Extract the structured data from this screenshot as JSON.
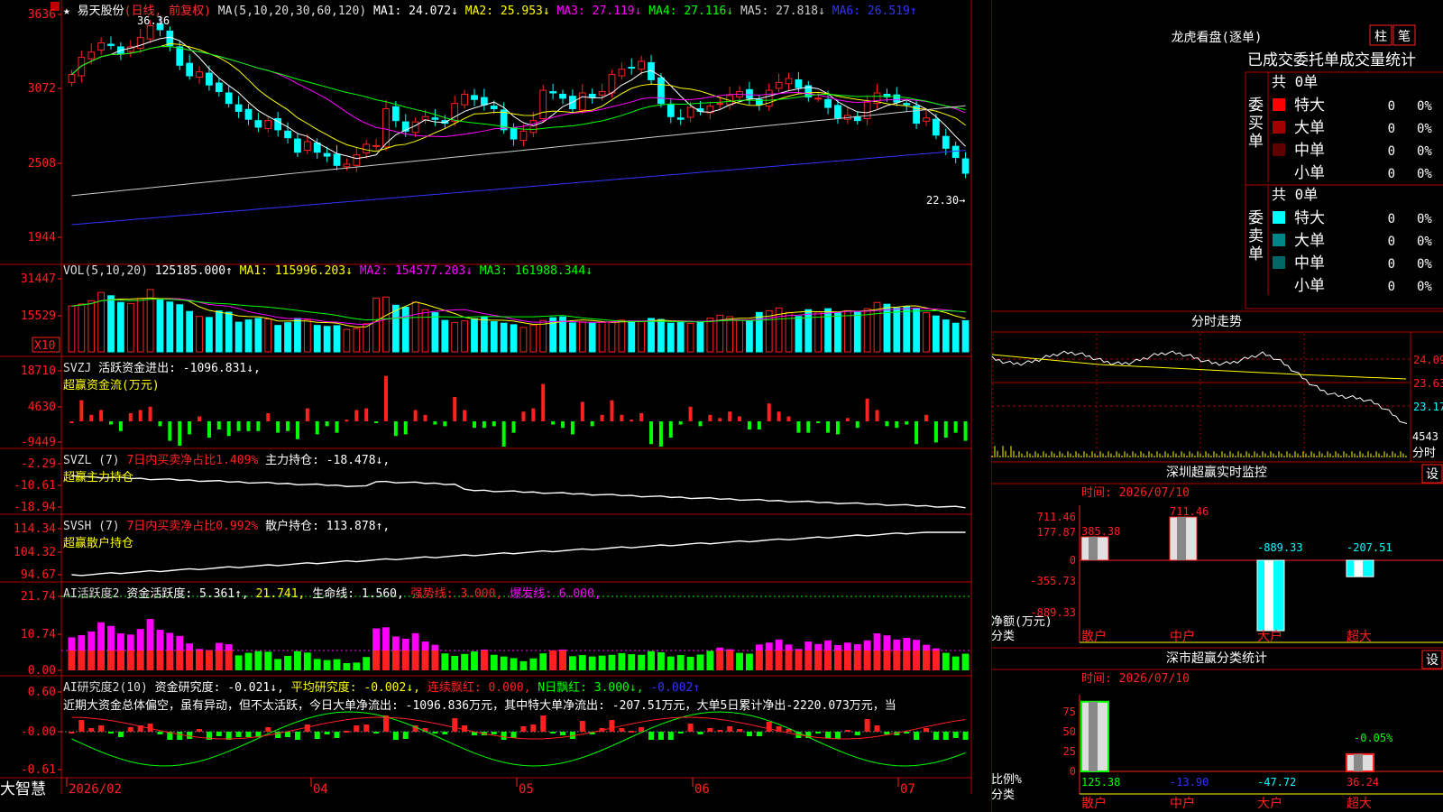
{
  "colors": {
    "up": "#ff2020",
    "down": "#00ffff",
    "grid": "#b00000",
    "bg": "#000000",
    "axis": "#ff3030"
  },
  "stock": {
    "name": "★ 易天股份",
    "mode": "(日线, 前复权)"
  },
  "main": {
    "ma_label": "MA(5,10,20,30,60,120)",
    "ma_items": [
      {
        "t": "MA1: 24.072↓",
        "c": "#ffffff"
      },
      {
        "t": "MA2: 25.953↓",
        "c": "#ffff00"
      },
      {
        "t": "MA3: 27.119↓",
        "c": "#ff00ff"
      },
      {
        "t": "MA4: 27.116↓",
        "c": "#00ff00"
      },
      {
        "t": "MA5: 27.818↓",
        "c": "#cccccc"
      },
      {
        "t": "MA6: 26.519↑",
        "c": "#3333ff"
      }
    ],
    "y_ticks": [
      "3636",
      "3072",
      "2508",
      "1944"
    ],
    "high_label": "36.36",
    "low_label": "22.30"
  },
  "vol": {
    "label": "VOL(5,10,20)",
    "value": "125185.000↑",
    "items": [
      {
        "t": "MA1: 115996.203↓",
        "c": "#ffff00"
      },
      {
        "t": "MA2: 154577.203↓",
        "c": "#ff00ff"
      },
      {
        "t": "MA3: 161988.344↓",
        "c": "#00ff00"
      }
    ],
    "y_ticks": [
      "31447",
      "15529"
    ],
    "unit": "X10"
  },
  "svzj": {
    "label": "SVZJ",
    "title": "活跃资金进出: -1096.831↓,",
    "sub": "超赢资金流(万元)",
    "y_ticks": [
      "18710",
      "4630",
      "-9449"
    ]
  },
  "svzl": {
    "label": "SVZL (7)",
    "pct": "7日内买卖净占比1.409%",
    "title": "主力持仓: -18.478↓,",
    "sub": "超赢主力持仓",
    "y_ticks": [
      "-2.29",
      "-10.61",
      "-18.94"
    ]
  },
  "svsh": {
    "label": "SVSH (7)",
    "pct": "7日内买卖净占比0.992%",
    "title": "散户持仓: 113.878↑,",
    "sub": "超赢散户持仓",
    "y_ticks": [
      "114.34",
      "104.32",
      "94.67"
    ]
  },
  "ai1": {
    "label": "AI活跃度2",
    "items": [
      {
        "t": "资金活跃度: 5.361↑,",
        "c": "#ffffff"
      },
      {
        "t": "21.741,",
        "c": "#ffff00"
      },
      {
        "t": "生命线: 1.560,",
        "c": "#ffffff"
      },
      {
        "t": "强势线: 3.000,",
        "c": "#ff2020"
      },
      {
        "t": "爆发线: 6.000,",
        "c": "#ff00ff"
      }
    ],
    "y_ticks": [
      "21.74",
      "10.74",
      "0.00"
    ]
  },
  "ai2": {
    "label": "AI研究度2(10)",
    "items": [
      {
        "t": "资金研究度: -0.021↓,",
        "c": "#ffffff"
      },
      {
        "t": "平均研究度: -0.002↓,",
        "c": "#ffff00"
      },
      {
        "t": "连续飘红: 0.000,",
        "c": "#ff2020"
      },
      {
        "t": "N日飘红: 3.000↓,",
        "c": "#00ff00"
      },
      {
        "t": "-0.002↑",
        "c": "#3333ff"
      }
    ],
    "comment": "近期大资金总体偏空，虽有异动，但不太活跃，今日大单净流出: -1096.836万元，其中特大单净流出: -207.51万元，大单5日累计净出-2220.073万元，当",
    "y_ticks": [
      "0.60",
      "-0.00",
      "-0.61"
    ]
  },
  "x_axis": {
    "labels": [
      "2026/02",
      "04",
      "05",
      "06",
      "07"
    ],
    "brand": "大智慧"
  },
  "right": {
    "dragon_title": "龙虎看盘(逐单)",
    "tab_zhu": "柱",
    "tab_bi": "笔",
    "stats_title": "已成交委托单成交量统计",
    "buy": {
      "side": "委买单",
      "total": "共 0单",
      "rows": [
        {
          "n": "特大",
          "v": "0",
          "p": "0%",
          "c": "#ff0000"
        },
        {
          "n": "大单",
          "v": "0",
          "p": "0%",
          "c": "#a00000"
        },
        {
          "n": "中单",
          "v": "0",
          "p": "0%",
          "c": "#600000"
        },
        {
          "n": "小单",
          "v": "0",
          "p": "0%",
          "c": "#000000"
        }
      ]
    },
    "sell": {
      "side": "委卖单",
      "total": "共 0单",
      "rows": [
        {
          "n": "特大",
          "v": "0",
          "p": "0%",
          "c": "#00ffff"
        },
        {
          "n": "大单",
          "v": "0",
          "p": "0%",
          "c": "#008888"
        },
        {
          "n": "中单",
          "v": "0",
          "p": "0%",
          "c": "#006666"
        },
        {
          "n": "小单",
          "v": "0",
          "p": "0%",
          "c": "#000000"
        }
      ]
    },
    "timeshare": {
      "title": "分时走势",
      "y_ticks": [
        "24.09",
        "23.63",
        "23.17"
      ],
      "vol": "4543",
      "unit": "分时"
    },
    "monitor": {
      "title": "深圳超赢实时监控",
      "btn": "设",
      "date": "时间: 2026/07/10",
      "y_ticks": [
        "711.46",
        "177.87",
        "0",
        "-355.73",
        "-889.33"
      ],
      "y_label": "净额(万元)",
      "cat_label": "分类",
      "cats": [
        "散户",
        "中户",
        "大户",
        "超大"
      ],
      "values": [
        385.38,
        711.46,
        -889.33,
        -207.51
      ],
      "value_labels": [
        "385.38",
        "711.46",
        "-889.33",
        "-207.51"
      ]
    },
    "classify": {
      "title": "深市超赢分类统计",
      "btn": "设",
      "date": "时间: 2026/07/10",
      "y_ticks": [
        "75",
        "50",
        "25",
        "0"
      ],
      "y_label": "比例%",
      "cat_label": "分类",
      "cats": [
        "散户",
        "中户",
        "大户",
        "超大"
      ],
      "values": [
        125.38,
        -13.9,
        -47.72,
        36.24
      ],
      "value_labels": [
        "125.38",
        "-13.90",
        "-47.72",
        "36.24"
      ],
      "pct_label": "-0.05%"
    }
  },
  "chart_data": {
    "type": "candlestick",
    "title": "易天股份",
    "x_labels": [
      "2026/02",
      "04",
      "05",
      "06",
      "07"
    ],
    "close": [
      31.8,
      33.1,
      33.5,
      34.2,
      34.0,
      33.4,
      33.9,
      34.6,
      35.5,
      35.2,
      34.0,
      32.5,
      31.7,
      32.0,
      31.0,
      30.5,
      29.6,
      29.0,
      28.4,
      27.8,
      28.3,
      27.6,
      27.0,
      25.9,
      26.7,
      25.9,
      25.6,
      24.9,
      25.0,
      25.7,
      26.5,
      26.4,
      29.2,
      28.3,
      27.5,
      28.2,
      28.6,
      28.4,
      28.1,
      29.6,
      30.3,
      29.9,
      29.5,
      29.2,
      27.6,
      26.9,
      27.5,
      28.3,
      30.6,
      30.4,
      30.0,
      29.2,
      30.4,
      30.1,
      30.5,
      31.8,
      32.2,
      32.3,
      32.8,
      31.4,
      29.6,
      28.6,
      28.4,
      29.3,
      29.0,
      29.4,
      29.6,
      30.2,
      30.5,
      30.0,
      29.5,
      30.6,
      31.2,
      31.5,
      30.8,
      30.1,
      30.0,
      29.3,
      28.5,
      28.7,
      28.3,
      29.7,
      30.4,
      30.1,
      29.7,
      29.5,
      28.1,
      28.5,
      27.2,
      26.2,
      25.5,
      24.3
    ],
    "volume": [
      18400,
      19200,
      20500,
      23800,
      22500,
      19800,
      19400,
      21400,
      25000,
      21100,
      20000,
      18900,
      16200,
      14200,
      13800,
      16400,
      15900,
      11900,
      12800,
      13400,
      13200,
      10600,
      11700,
      13400,
      12900,
      10600,
      10200,
      10500,
      9000,
      9300,
      11300,
      21600,
      22000,
      18700,
      17900,
      19900,
      16900,
      15700,
      12600,
      11700,
      12400,
      13300,
      14000,
      12100,
      11500,
      10900,
      9800,
      10800,
      12600,
      13700,
      14000,
      11600,
      12000,
      11500,
      11800,
      12100,
      12700,
      12300,
      12100,
      13400,
      13000,
      11500,
      12000,
      11400,
      12200,
      13500,
      14700,
      14100,
      12800,
      12500,
      15800,
      16500,
      17600,
      15800,
      14200,
      16900,
      16000,
      17300,
      15600,
      16500,
      15900,
      17300,
      19800,
      19100,
      17600,
      18200,
      17500,
      15700,
      14400,
      12800,
      11500,
      12500
    ]
  }
}
